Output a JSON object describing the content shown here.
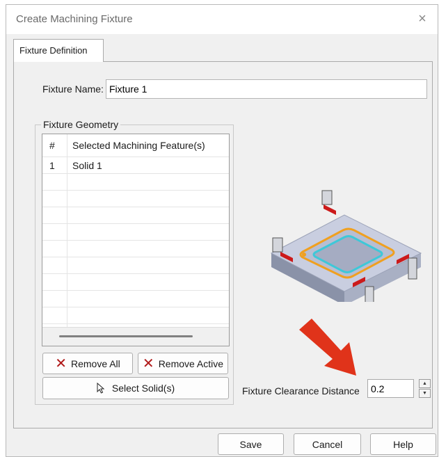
{
  "window": {
    "title": "Create Machining Fixture",
    "close_glyph": "×"
  },
  "tabs": [
    {
      "label": "Fixture Definition",
      "active": true
    }
  ],
  "fixture_name": {
    "label": "Fixture Name:",
    "value": "Fixture 1"
  },
  "geometry": {
    "group_label": "Fixture Geometry",
    "columns": [
      "#",
      "Selected Machining Feature(s)"
    ],
    "rows": [
      {
        "num": "1",
        "feature": "Solid 1"
      }
    ],
    "empty_rows": 10,
    "remove_all_label": "Remove All",
    "remove_active_label": "Remove Active",
    "select_solids_label": "Select Solid(s)"
  },
  "clearance": {
    "label": "Fixture Clearance Distance",
    "value": "0.2"
  },
  "footer": {
    "save_label": "Save",
    "cancel_label": "Cancel",
    "help_label": "Help"
  },
  "colors": {
    "arrow": "#e0331a",
    "pocket_outline": "#f0a020",
    "pocket_inner": "#3ec8d8",
    "clamp_accent": "#cc1a1a",
    "remove_x": "#b01818"
  },
  "icons": {
    "close": "close-icon",
    "remove": "x-icon",
    "select": "cursor-arrow-icon",
    "spin_up": "chevron-up-icon",
    "spin_down": "chevron-down-icon"
  }
}
